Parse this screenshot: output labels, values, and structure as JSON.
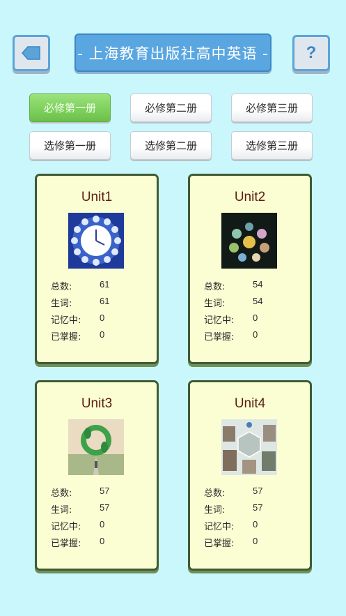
{
  "header": {
    "title": "- 上海教育出版社高中英语 -",
    "help_label": "?"
  },
  "volumes": [
    {
      "label": "必修第一册",
      "active": true
    },
    {
      "label": "必修第二册",
      "active": false
    },
    {
      "label": "必修第三册",
      "active": false
    },
    {
      "label": "选修第一册",
      "active": false
    },
    {
      "label": "选修第二册",
      "active": false
    },
    {
      "label": "选修第三册",
      "active": false
    }
  ],
  "stat_labels": {
    "total": "总数:",
    "new": "生词:",
    "memorizing": "记忆中:",
    "mastered": "已掌握:"
  },
  "units": [
    {
      "title": "Unit1",
      "total": "61",
      "new": "61",
      "memorizing": "0",
      "mastered": "0",
      "icon": "clock-image"
    },
    {
      "title": "Unit2",
      "total": "54",
      "new": "54",
      "memorizing": "0",
      "mastered": "0",
      "icon": "planets-image"
    },
    {
      "title": "Unit3",
      "total": "57",
      "new": "57",
      "memorizing": "0",
      "mastered": "0",
      "icon": "footprint-recycle-image"
    },
    {
      "title": "Unit4",
      "total": "57",
      "new": "57",
      "memorizing": "0",
      "mastered": "0",
      "icon": "buildings-hexagon-image"
    }
  ],
  "colors": {
    "background": "#c9f7fb",
    "title_blue": "#5aa6e0",
    "active_green": "#7ccf5a",
    "card_fill": "#fbfed3",
    "card_border": "#3f5b34",
    "unit_title": "#5a1e12"
  }
}
